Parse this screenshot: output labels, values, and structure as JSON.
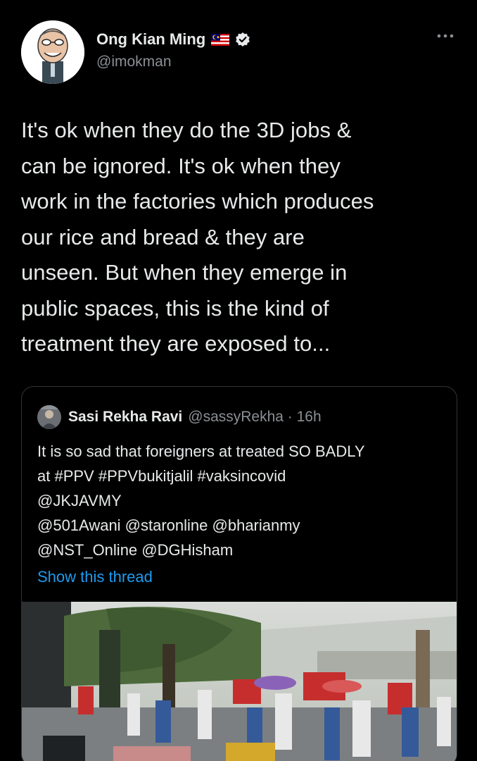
{
  "author": {
    "name": "Ong Kian Ming",
    "handle": "@imokman",
    "flag_icon": "malaysia-flag-icon",
    "verified_icon": "verified-badge-icon"
  },
  "more_icon": "more-options-icon",
  "tweet": {
    "lines": [
      "It's ok when they do the 3D jobs &",
      "can be ignored. It's ok when they",
      "work in the factories which produces",
      "our rice and bread & they are",
      "unseen. But when they emerge in",
      "public spaces, this is the kind of",
      "treatment they are exposed to..."
    ]
  },
  "quote": {
    "name": "Sasi Rekha Ravi",
    "handle_time": "@sassyRekha · 16h",
    "lines": [
      "It is so sad that foreigners at treated SO BADLY",
      "at #PPV #PPVbukitjalil #vaksincovid",
      "@JKJAVMY",
      "@501Awani @staronline @bharianmy",
      "@NST_Online @DGHisham"
    ],
    "show_thread": "Show this thread"
  },
  "colors": {
    "background": "#000000",
    "text": "#e7e9ea",
    "secondary": "#8b8f94",
    "link": "#1d9bf0",
    "border": "#2f3336"
  }
}
